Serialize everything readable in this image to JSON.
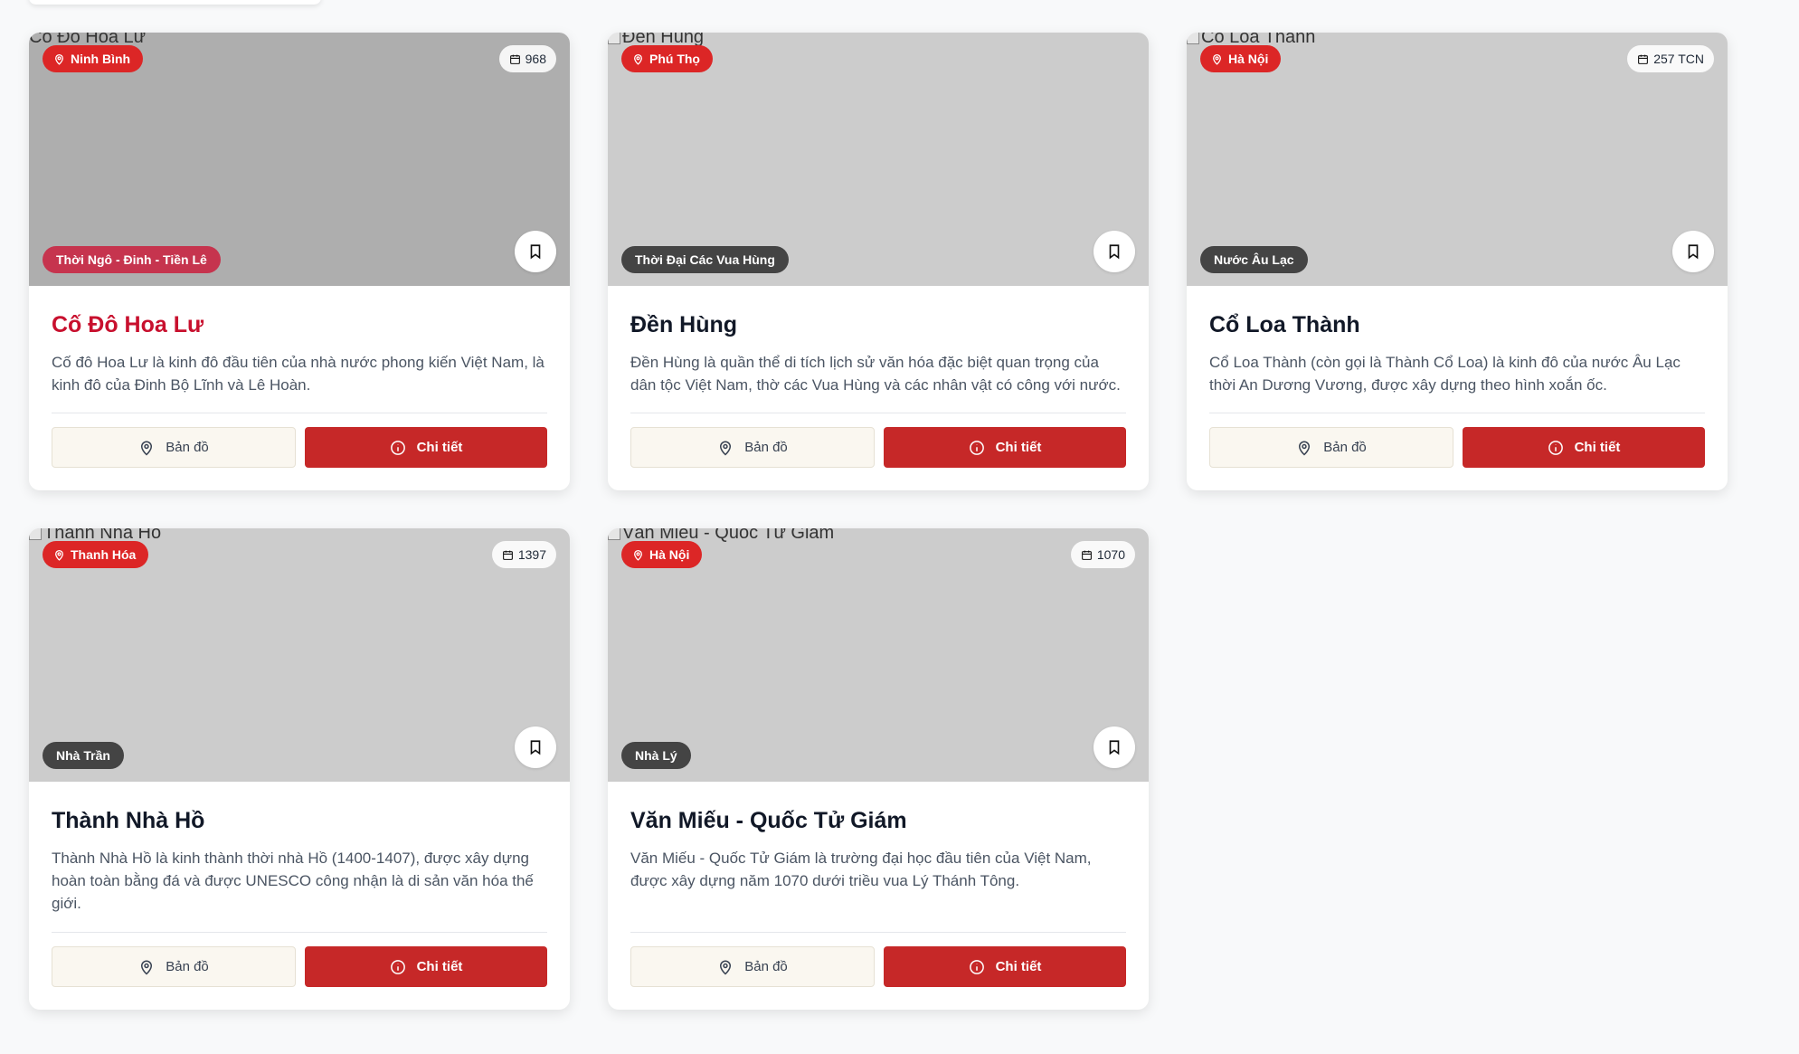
{
  "labels": {
    "map": "Bản đồ",
    "detail": "Chi tiết"
  },
  "colors": {
    "primary": "#c62828",
    "location_badge": "#dc2626",
    "era_badge": "#444444",
    "era_badge_accent": "#c6344e",
    "title_accent": "#c8102e"
  },
  "sites": [
    {
      "image_alt": "Cố Đô Hoa Lư",
      "location": "Ninh Bình",
      "year": "968",
      "era": "Thời Ngô - Đinh - Tiền Lê",
      "title": "Cố Đô Hoa Lư",
      "description": "Cố đô Hoa Lư là kinh đô đầu tiên của nhà nước phong kiến Việt Nam, là kinh đô của Đinh Bộ Lĩnh và Lê Hoàn."
    },
    {
      "image_alt": "Đền Hùng",
      "location": "Phú Thọ",
      "year": "",
      "era": "Thời Đại Các Vua Hùng",
      "title": "Đền Hùng",
      "description": "Đền Hùng là quần thể di tích lịch sử văn hóa đặc biệt quan trọng của dân tộc Việt Nam, thờ các Vua Hùng và các nhân vật có công với nước."
    },
    {
      "image_alt": "Cổ Loa Thành",
      "location": "Hà Nội",
      "year": "257 TCN",
      "era": "Nước Âu Lạc",
      "title": "Cổ Loa Thành",
      "description": "Cổ Loa Thành (còn gọi là Thành Cổ Loa) là kinh đô của nước Âu Lạc thời An Dương Vương, được xây dựng theo hình xoắn ốc."
    },
    {
      "image_alt": "Thành Nhà Hồ",
      "location": "Thanh Hóa",
      "year": "1397",
      "era": "Nhà Trần",
      "title": "Thành Nhà Hồ",
      "description": "Thành Nhà Hồ là kinh thành thời nhà Hồ (1400-1407), được xây dựng hoàn toàn bằng đá và được UNESCO công nhận là di sản văn hóa thế giới."
    },
    {
      "image_alt": "Văn Miếu - Quốc Tử Giám",
      "location": "Hà Nội",
      "year": "1070",
      "era": "Nhà Lý",
      "title": "Văn Miếu - Quốc Tử Giám",
      "description": "Văn Miếu - Quốc Tử Giám là trường đại học đầu tiên của Việt Nam, được xây dựng năm 1070 dưới triều vua Lý Thánh Tông."
    }
  ]
}
